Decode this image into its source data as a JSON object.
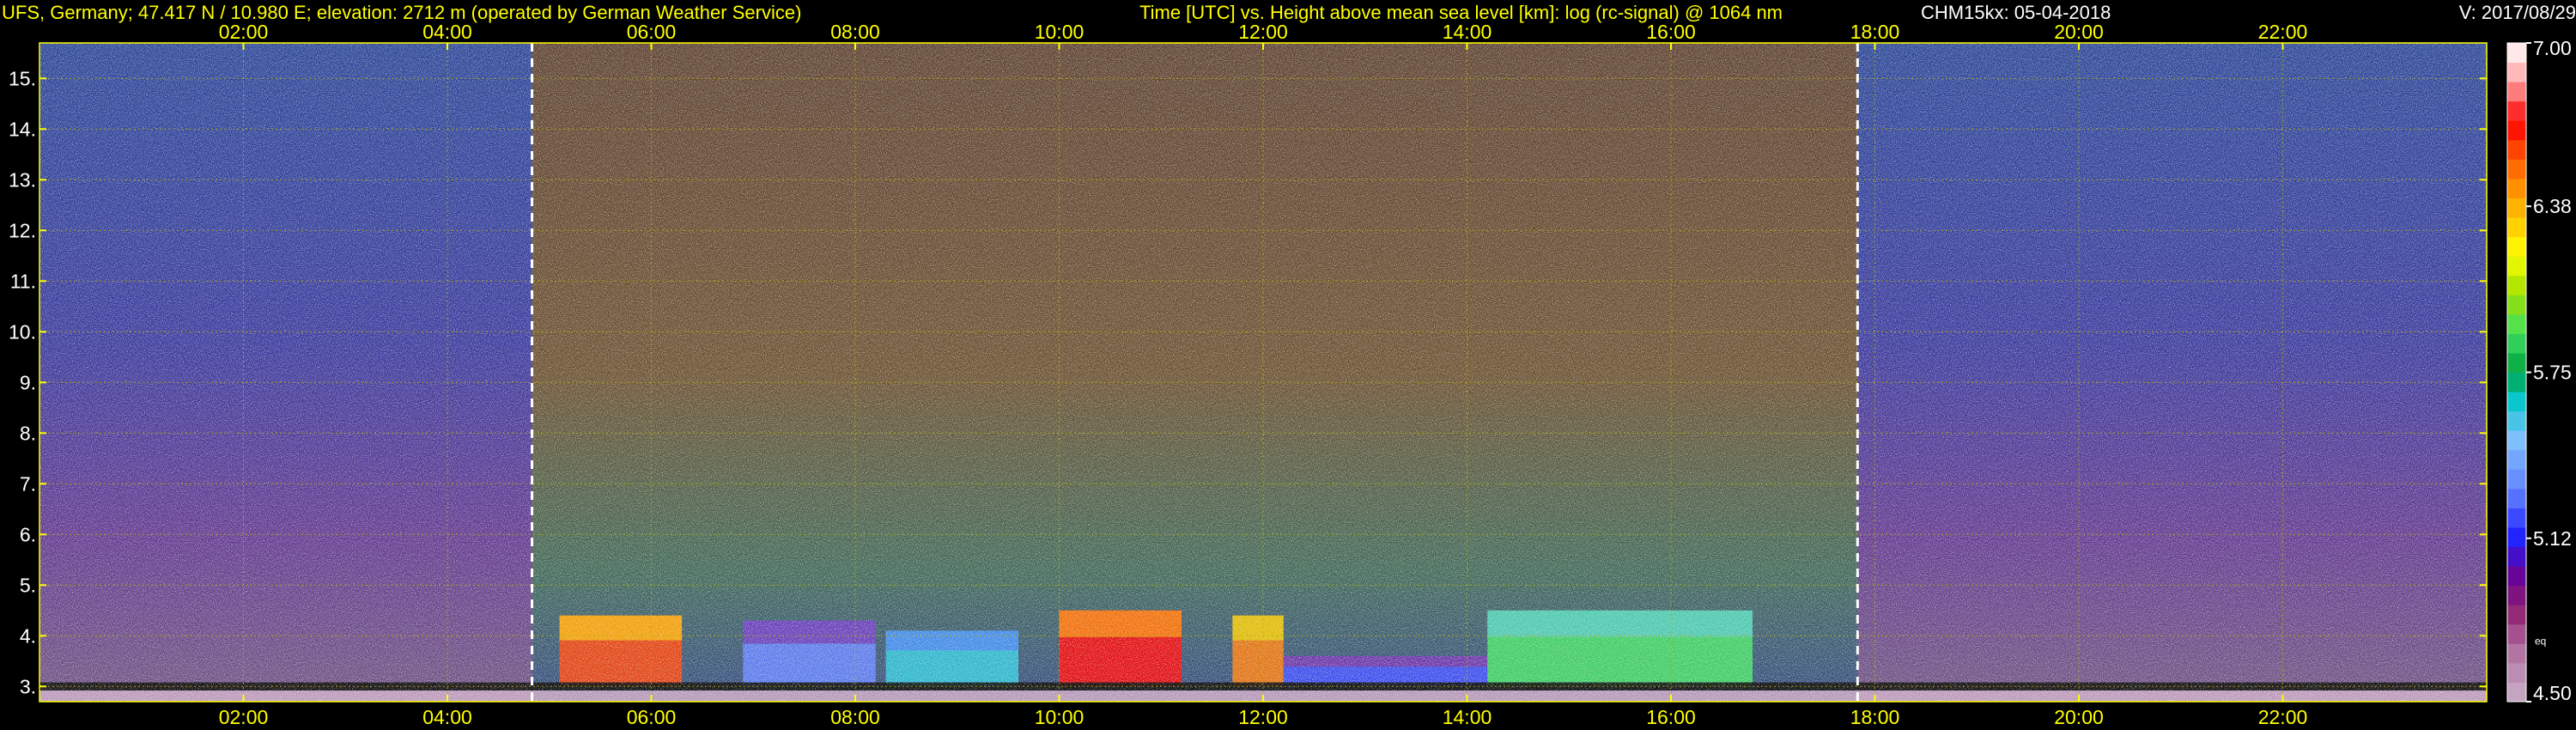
{
  "header": {
    "station": "UFS, Germany; 47.417 N / 10.980 E; elevation: 2712 m  (operated by German Weather Service)",
    "description": "Time [UTC] vs. Height above mean sea level [km]: log (rc-signal) @ 1064 nm",
    "instrument_date": "CHM15kx: 05-04-2018",
    "version": "V: 2017/08/29"
  },
  "colors": {
    "header_text": "#ffff00",
    "tick_text": "#ffff00",
    "grid": "#b4b400",
    "info_text": "#ffffff",
    "background": "#000000"
  },
  "chart_data": {
    "type": "heatmap",
    "title": "Time [UTC] vs. Height above mean sea level [km]: log (rc-signal) @ 1064 nm",
    "xlabel": "Time [UTC]",
    "ylabel": "Height above mean sea level [km]",
    "x_unit": "hours UTC",
    "y_unit": "km",
    "xlim": [
      0.0,
      24.0
    ],
    "ylim": [
      2.7,
      15.7
    ],
    "x_ticks": [
      {
        "value": 2,
        "label": "02:00"
      },
      {
        "value": 4,
        "label": "04:00"
      },
      {
        "value": 6,
        "label": "06:00"
      },
      {
        "value": 8,
        "label": "08:00"
      },
      {
        "value": 10,
        "label": "10:00"
      },
      {
        "value": 12,
        "label": "12:00"
      },
      {
        "value": 14,
        "label": "14:00"
      },
      {
        "value": 16,
        "label": "16:00"
      },
      {
        "value": 18,
        "label": "18:00"
      },
      {
        "value": 20,
        "label": "20:00"
      },
      {
        "value": 22,
        "label": "22:00"
      }
    ],
    "y_ticks": [
      {
        "value": 3,
        "label": "3."
      },
      {
        "value": 4,
        "label": "4."
      },
      {
        "value": 5,
        "label": "5."
      },
      {
        "value": 6,
        "label": "6."
      },
      {
        "value": 7,
        "label": "7."
      },
      {
        "value": 8,
        "label": "8."
      },
      {
        "value": 9,
        "label": "9."
      },
      {
        "value": 10,
        "label": "10."
      },
      {
        "value": 11,
        "label": "11."
      },
      {
        "value": 12,
        "label": "12."
      },
      {
        "value": 13,
        "label": "13."
      },
      {
        "value": 14,
        "label": "14."
      },
      {
        "value": 15,
        "label": "15."
      }
    ],
    "grid": true,
    "sunrise_line_hour": 4.83,
    "sunset_line_hour": 17.83,
    "colorbar": {
      "min": 4.5,
      "max": 7.0,
      "ticks": [
        {
          "value": 7.0,
          "label": "7.00"
        },
        {
          "value": 6.38,
          "label": "6.38"
        },
        {
          "value": 5.75,
          "label": "5.75"
        },
        {
          "value": 5.12,
          "label": "5.12"
        },
        {
          "value": 4.5,
          "label": "4.50"
        }
      ],
      "marker": {
        "value": 4.73,
        "label": "eq"
      },
      "stops": [
        {
          "value": 4.5,
          "color": "#c8b0c8"
        },
        {
          "value": 4.7,
          "color": "#b070a0"
        },
        {
          "value": 4.85,
          "color": "#902070"
        },
        {
          "value": 5.0,
          "color": "#6000a0"
        },
        {
          "value": 5.12,
          "color": "#2020ff"
        },
        {
          "value": 5.3,
          "color": "#6080ff"
        },
        {
          "value": 5.5,
          "color": "#80c0ff"
        },
        {
          "value": 5.65,
          "color": "#00c8c8"
        },
        {
          "value": 5.75,
          "color": "#00a040"
        },
        {
          "value": 5.9,
          "color": "#40e060"
        },
        {
          "value": 6.05,
          "color": "#a0e000"
        },
        {
          "value": 6.2,
          "color": "#ffff00"
        },
        {
          "value": 6.38,
          "color": "#ffb000"
        },
        {
          "value": 6.55,
          "color": "#ff6000"
        },
        {
          "value": 6.7,
          "color": "#ff0000"
        },
        {
          "value": 6.85,
          "color": "#ffa0a0"
        },
        {
          "value": 7.0,
          "color": "#ffffff"
        }
      ]
    },
    "features": {
      "night_background": "#2a2a80",
      "day_background": "#6a4a2a",
      "aerosol_layers": [
        {
          "start": 5.1,
          "end": 6.3,
          "top": 4.4,
          "value": 6.6
        },
        {
          "start": 6.9,
          "end": 8.2,
          "top": 4.3,
          "value": 5.3
        },
        {
          "start": 8.3,
          "end": 9.6,
          "top": 4.1,
          "value": 5.6
        },
        {
          "start": 10.0,
          "end": 11.2,
          "top": 4.5,
          "value": 6.7
        },
        {
          "start": 11.7,
          "end": 12.2,
          "top": 4.4,
          "value": 6.5
        },
        {
          "start": 12.2,
          "end": 14.2,
          "top": 3.6,
          "value": 5.2
        },
        {
          "start": 14.2,
          "end": 16.8,
          "top": 4.5,
          "value": 5.9
        }
      ]
    }
  }
}
